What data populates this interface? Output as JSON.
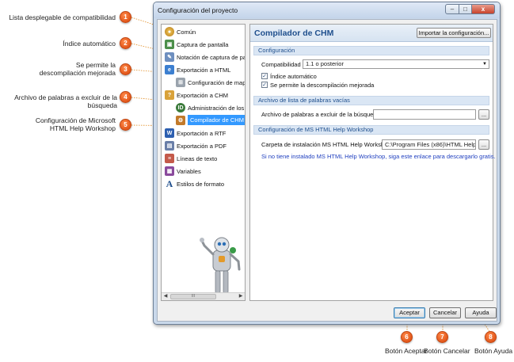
{
  "window": {
    "title": "Configuración del proyecto",
    "controls": {
      "minimize": "–",
      "maximize": "□",
      "close": "x"
    }
  },
  "tree": {
    "items": [
      {
        "label": "Común",
        "icon": "common-icon"
      },
      {
        "label": "Captura de pantalla",
        "icon": "screenshot-icon"
      },
      {
        "label": "Notación de captura de pantal",
        "icon": "annotation-icon"
      },
      {
        "label": "Exportación a HTML",
        "icon": "html-export-icon"
      },
      {
        "label": "Configuración de mapa y",
        "icon": "sitemap-icon"
      },
      {
        "label": "Exportación a CHM",
        "icon": "chm-export-icon"
      },
      {
        "label": "Administración de los He",
        "icon": "help-ids-icon"
      },
      {
        "label": "Compilador de CHM",
        "icon": "chm-compiler-icon",
        "selected": true
      },
      {
        "label": "Exportación a RTF",
        "icon": "rtf-export-icon"
      },
      {
        "label": "Exportación a PDF",
        "icon": "pdf-export-icon"
      },
      {
        "label": "Líneas de texto",
        "icon": "text-lines-icon"
      },
      {
        "label": "Variables",
        "icon": "variables-icon"
      },
      {
        "label": "Estilos de formato",
        "icon": "format-styles-icon"
      }
    ],
    "scroll_thumb": "III"
  },
  "panel": {
    "title": "Compilador de CHM",
    "import_button": "Importar la configuración...",
    "sections": {
      "config": "Configuración",
      "stopwords": "Archivo de lista de palabras vacías",
      "workshop": "Configuración de MS HTML Help Workshop"
    },
    "compat_label": "Compatibilidad",
    "compat_value": "1.1 o posterior",
    "auto_index_label": "Índice automático",
    "auto_index_checked": true,
    "decompile_label": "Se permite la descompilación mejorada",
    "decompile_checked": true,
    "stopwords_label": "Archivo de palabras a excluir de la búsqueda",
    "stopwords_value": "",
    "browse_label": "...",
    "workshop_label": "Carpeta de instalación MS HTML Help Workshop",
    "workshop_value": "C:\\Program Files (x86)\\HTML Help Wor",
    "workshop_link": "Si no tiene instalado MS HTML Help Workshop, siga este enlace para descargarlo gratis."
  },
  "buttons": {
    "ok": "Aceptar",
    "cancel": "Cancelar",
    "help": "Ayuda"
  },
  "annotations": [
    {
      "n": "1",
      "text": "Lista desplegable de compatibilidad"
    },
    {
      "n": "2",
      "text": "Índice automático"
    },
    {
      "n": "3",
      "text": "Se permite la descompilación mejorada"
    },
    {
      "n": "4",
      "text": "Archivo de palabras a excluir de la búsqueda"
    },
    {
      "n": "5",
      "text": "Configuración de Microsoft HTML Help Workshop"
    },
    {
      "n": "6",
      "text": "Botón Aceptar"
    },
    {
      "n": "7",
      "text": "Botón Cancelar"
    },
    {
      "n": "8",
      "text": "Botón Ayuda"
    }
  ],
  "colors": {
    "accent": "#1f4f8d",
    "badge": "#e2571b",
    "selection": "#3399ff",
    "link": "#1f3fbf"
  }
}
